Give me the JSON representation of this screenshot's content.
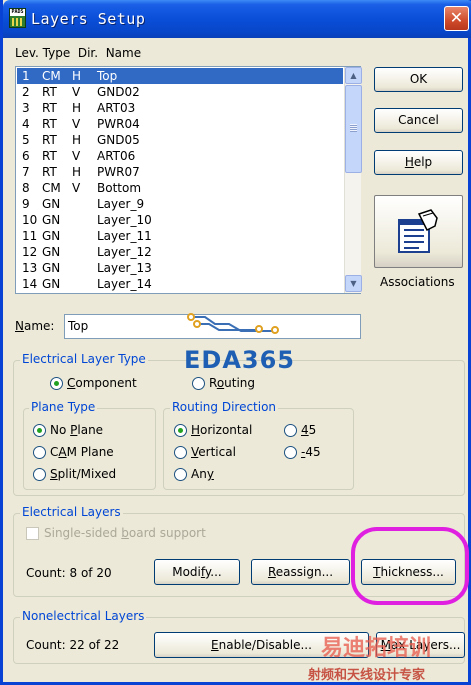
{
  "window": {
    "title": "Layers Setup",
    "close_glyph": "✕",
    "icon_text": "PADS"
  },
  "list": {
    "header": "Lev. Type  Dir.  Name",
    "rows": [
      {
        "lev": "1",
        "type": "CM",
        "dir": "H",
        "name": "Top"
      },
      {
        "lev": "2",
        "type": "RT",
        "dir": "V",
        "name": "GND02"
      },
      {
        "lev": "3",
        "type": "RT",
        "dir": "H",
        "name": "ART03"
      },
      {
        "lev": "4",
        "type": "RT",
        "dir": "V",
        "name": "PWR04"
      },
      {
        "lev": "5",
        "type": "RT",
        "dir": "H",
        "name": "GND05"
      },
      {
        "lev": "6",
        "type": "RT",
        "dir": "V",
        "name": "ART06"
      },
      {
        "lev": "7",
        "type": "RT",
        "dir": "H",
        "name": "PWR07"
      },
      {
        "lev": "8",
        "type": "CM",
        "dir": "V",
        "name": "Bottom"
      },
      {
        "lev": "9",
        "type": "GN",
        "dir": "",
        "name": "Layer_9"
      },
      {
        "lev": "10",
        "type": "GN",
        "dir": "",
        "name": "Layer_10"
      },
      {
        "lev": "11",
        "type": "GN",
        "dir": "",
        "name": "Layer_11"
      },
      {
        "lev": "12",
        "type": "GN",
        "dir": "",
        "name": "Layer_12"
      },
      {
        "lev": "13",
        "type": "GN",
        "dir": "",
        "name": "Layer_13"
      },
      {
        "lev": "14",
        "type": "GN",
        "dir": "",
        "name": "Layer_14"
      }
    ],
    "selected_index": 0
  },
  "buttons": {
    "ok": "OK",
    "cancel": "Cancel",
    "help": "Help",
    "associations": "Associations",
    "modify": "Modify...",
    "reassign": "Reassign...",
    "thickness": "Thickness...",
    "enable_disable": "Enable/Disable...",
    "max_layers": "Max Layers..."
  },
  "name_field": {
    "label": "Name:",
    "value": "Top"
  },
  "electrical_layer_type": {
    "title": "Electrical Layer Type",
    "component": "Component",
    "routing": "Routing",
    "selected": "Component"
  },
  "plane_type": {
    "title": "Plane Type",
    "options": [
      "No Plane",
      "CAM Plane",
      "Split/Mixed"
    ],
    "selected": "No Plane"
  },
  "routing_direction": {
    "title": "Routing Direction",
    "options": [
      "Horizontal",
      "Vertical",
      "Any",
      "45",
      "-45"
    ],
    "selected": "Horizontal"
  },
  "electrical_layers": {
    "title": "Electrical Layers",
    "single_sided": "Single-sided board support",
    "count": "Count:  8 of 20"
  },
  "nonelectrical_layers": {
    "title": "Nonelectrical Layers",
    "count": "Count: 22 of 22"
  },
  "watermarks": {
    "eda": "EDA365",
    "cn_top": "易迪拓培训",
    "cn_bottom": "射频和天线设计专家"
  },
  "colors": {
    "title_blue": "#0a4ed8",
    "selection": "#316ac5",
    "group_title": "#0046d5",
    "highlight": "#e020e0"
  }
}
